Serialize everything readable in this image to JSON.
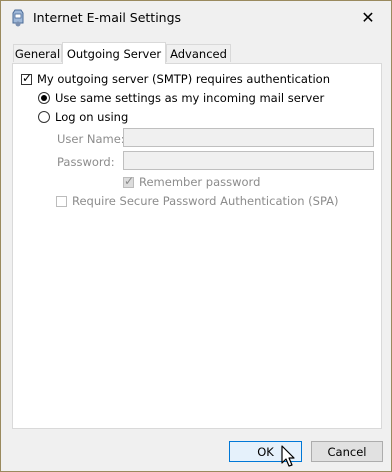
{
  "window": {
    "title": "Internet E-mail Settings",
    "close_glyph": "✕",
    "icon": "mail-settings-icon"
  },
  "tabs": [
    {
      "label": "General",
      "active": false
    },
    {
      "label": "Outgoing Server",
      "active": true
    },
    {
      "label": "Advanced",
      "active": false
    }
  ],
  "outgoing": {
    "requires_auth_label": "My outgoing server (SMTP) requires authentication",
    "requires_auth_checked": true,
    "same_settings_label": "Use same settings as my incoming mail server",
    "same_settings_selected": true,
    "log_on_label": "Log on using",
    "log_on_selected": false,
    "user_name_label": "User Name:",
    "user_name_value": "",
    "password_label": "Password:",
    "password_value": "",
    "remember_password_label": "Remember password",
    "remember_password_checked": true,
    "spa_label": "Require Secure Password Authentication (SPA)",
    "spa_checked": false
  },
  "buttons": {
    "ok_label": "OK",
    "cancel_label": "Cancel"
  },
  "colors": {
    "accent": "#0078d7",
    "desktop": "#b89b52"
  }
}
